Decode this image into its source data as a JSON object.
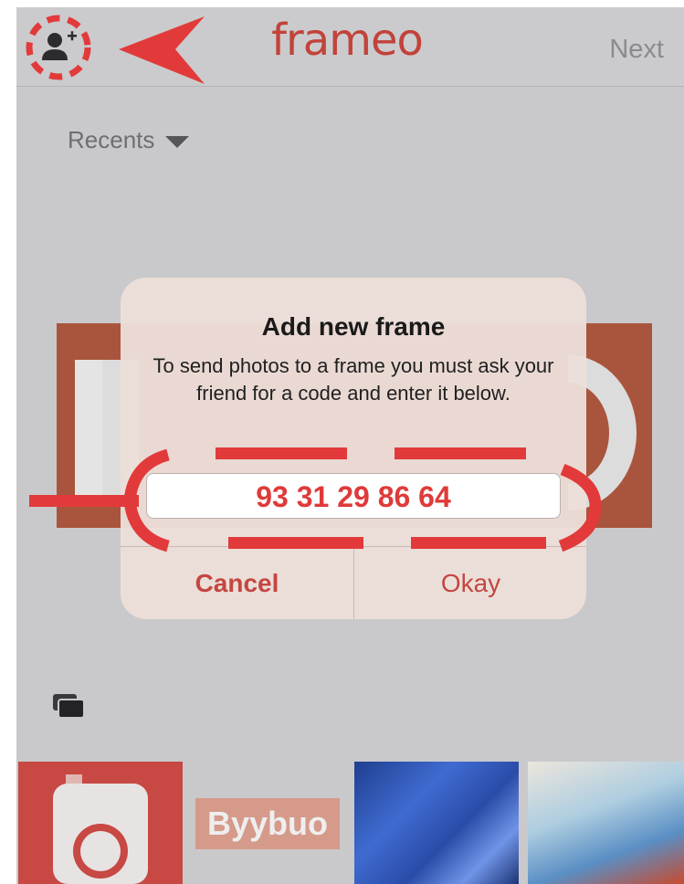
{
  "topbar": {
    "logo_text": "frameo",
    "next_label": "Next",
    "add_friend_icon": "add-person-icon",
    "accent_color": "#c1433a"
  },
  "gallery": {
    "album_label": "Recents"
  },
  "dialog": {
    "title": "Add new frame",
    "message": "To send photos to a frame you must ask your friend for a code and enter it below.",
    "code_value": "93 31 29 86 64",
    "cancel_label": "Cancel",
    "okay_label": "Okay"
  },
  "thumbnails": {
    "byybuo_text": "Byybuo"
  },
  "annotation_color": "#e23a3a"
}
